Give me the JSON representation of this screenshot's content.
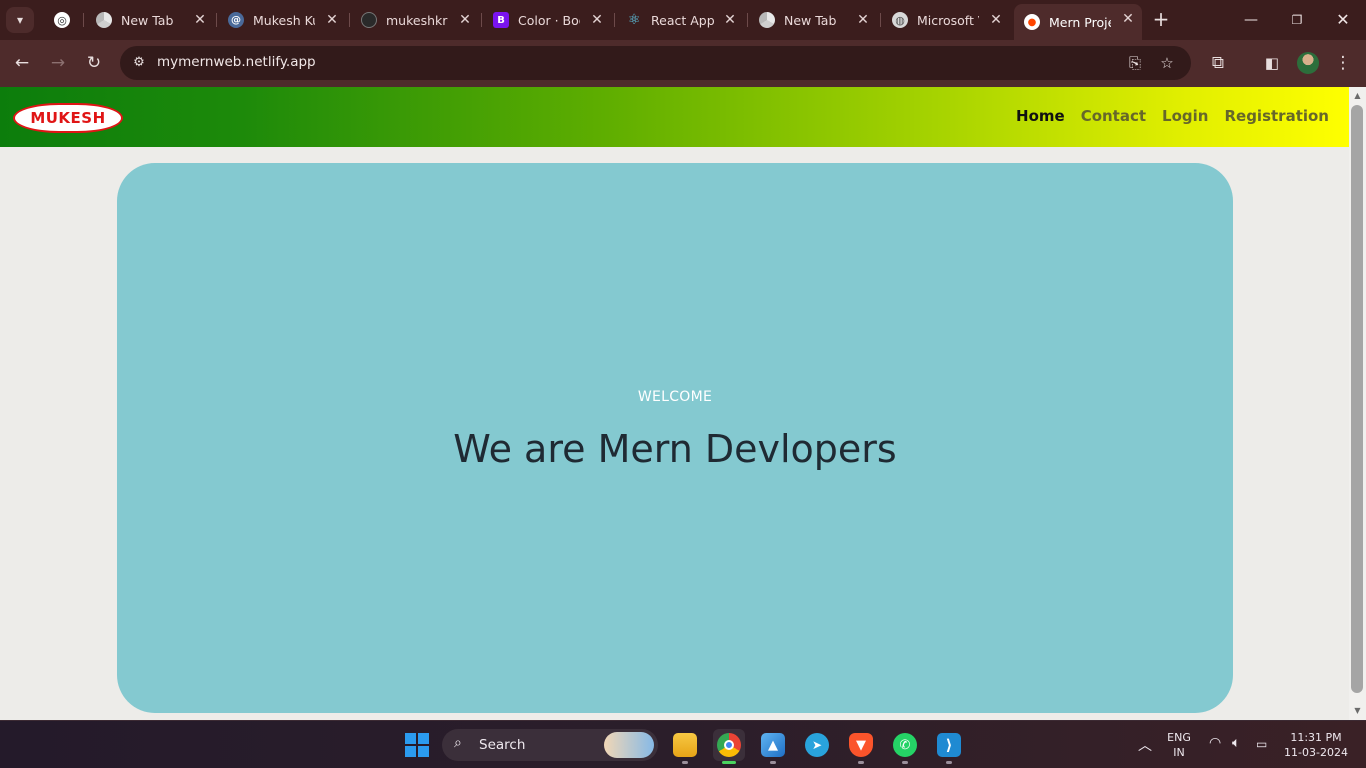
{
  "browser": {
    "tabs": [
      {
        "label": "",
        "icon": "openai-icon",
        "active": false
      },
      {
        "label": "New Tab",
        "icon": "chrome-icon",
        "active": false
      },
      {
        "label": "Mukesh Kur",
        "icon": "swirl-icon",
        "active": false
      },
      {
        "label": "mukeshkrm",
        "icon": "github-icon",
        "active": false
      },
      {
        "label": "Color · Boot",
        "icon": "bootstrap-icon",
        "active": false
      },
      {
        "label": "React App",
        "icon": "react-icon",
        "active": false
      },
      {
        "label": "New Tab",
        "icon": "chrome-icon",
        "active": false
      },
      {
        "label": "Microsoft V",
        "icon": "globe-icon",
        "active": false
      },
      {
        "label": "Mern Projec",
        "icon": "reddit-icon",
        "active": true
      }
    ],
    "url": "mymernweb.netlify.app"
  },
  "site": {
    "logo_text": "MUKESH",
    "nav": {
      "home": "Home",
      "contact": "Contact",
      "login": "Login",
      "registration": "Registration"
    },
    "hero": {
      "welcome": "WELCOME",
      "title": "We are Mern Devlopers"
    },
    "colors": {
      "hero_bg": "#84c9d0",
      "nav_gradient_start": "#0c7d0c",
      "nav_gradient_end": "#ffff00",
      "logo_red": "#e01515"
    }
  },
  "taskbar": {
    "search_label": "Search",
    "language": "ENG",
    "region": "IN",
    "time": "11:31 PM",
    "date": "11-03-2024",
    "apps": [
      "file-explorer-icon",
      "chrome-icon",
      "photos-icon",
      "telegram-icon",
      "brave-icon",
      "whatsapp-icon",
      "vscode-icon"
    ]
  }
}
